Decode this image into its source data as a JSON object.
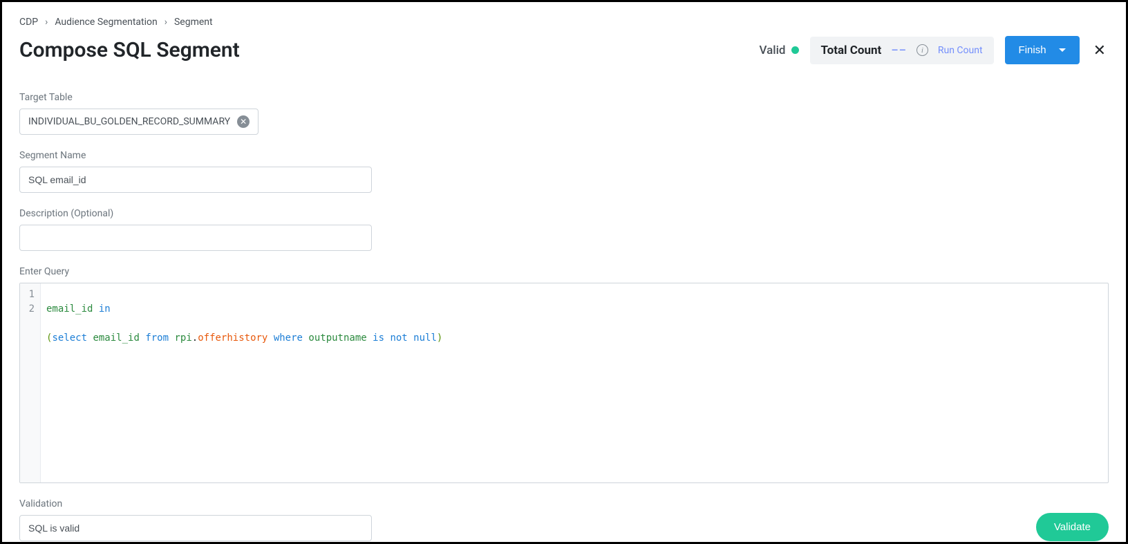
{
  "breadcrumb": {
    "level1": "CDP",
    "level2": "Audience Segmentation",
    "level3": "Segment"
  },
  "page": {
    "title": "Compose SQL Segment"
  },
  "status": {
    "valid_label": "Valid"
  },
  "count_panel": {
    "label": "Total Count",
    "value": "––",
    "run_count_label": "Run Count"
  },
  "buttons": {
    "finish": "Finish",
    "validate": "Validate"
  },
  "form": {
    "target_table": {
      "label": "Target Table",
      "value": "INDIVIDUAL_BU_GOLDEN_RECORD_SUMMARY"
    },
    "segment_name": {
      "label": "Segment Name",
      "value": "SQL email_id"
    },
    "description": {
      "label": "Description (Optional)",
      "value": ""
    },
    "query": {
      "label": "Enter Query",
      "line_numbers": [
        "1",
        "2"
      ],
      "tokens": {
        "l1_a": "email_id",
        "l1_b": "in",
        "l2_a": "(",
        "l2_b": "select",
        "l2_c": "email_id",
        "l2_d": "from",
        "l2_e": "rpi",
        "l2_dot": ".",
        "l2_f": "offerhistory",
        "l2_g": "where",
        "l2_h": "outputname",
        "l2_i": "is",
        "l2_j": "not",
        "l2_k": "null",
        "l2_l": ")"
      }
    },
    "validation": {
      "label": "Validation",
      "value": "SQL is valid"
    }
  }
}
